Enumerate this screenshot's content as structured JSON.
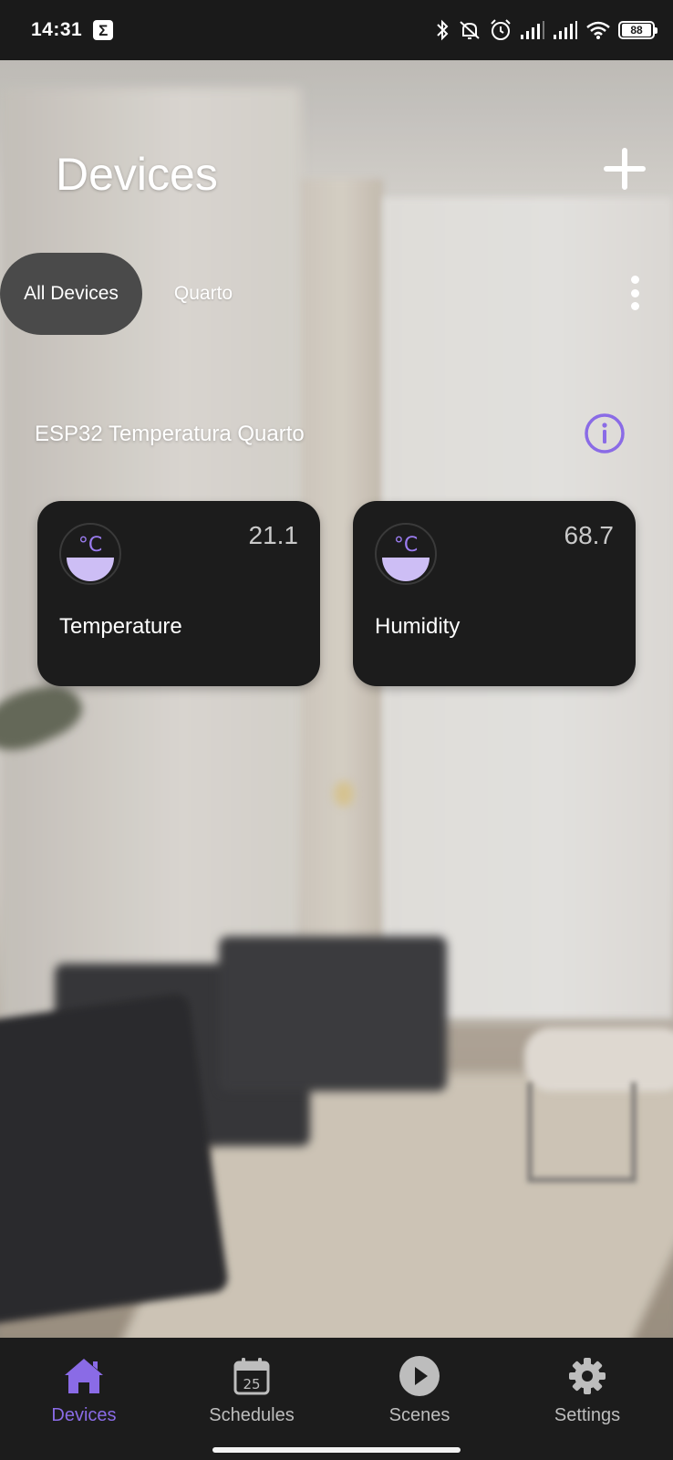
{
  "status_bar": {
    "time": "14:31",
    "app_badge_icon": "sigma-icon",
    "icons": [
      "bluetooth-icon",
      "mute-icon",
      "alarm-icon",
      "signal-icon",
      "signal-icon",
      "wifi-icon"
    ],
    "battery": "88"
  },
  "header": {
    "title": "Devices",
    "add_icon": "plus-icon"
  },
  "filters": {
    "chips": [
      {
        "label": "All Devices",
        "selected": true
      },
      {
        "label": "Quarto",
        "selected": false
      }
    ],
    "more_icon": "more-vertical-icon"
  },
  "device_group": {
    "name": "ESP32 Temperatura Quarto",
    "info_icon": "info-icon",
    "sensors": [
      {
        "label": "Temperature",
        "value": "21.1",
        "unit_icon": "celsius-icon"
      },
      {
        "label": "Humidity",
        "value": "68.7",
        "unit_icon": "celsius-icon"
      }
    ]
  },
  "bottom_nav": {
    "items": [
      {
        "label": "Devices",
        "icon": "home-icon",
        "active": true
      },
      {
        "label": "Schedules",
        "icon": "calendar-icon",
        "calendar_day": "25",
        "active": false
      },
      {
        "label": "Scenes",
        "icon": "play-icon",
        "active": false
      },
      {
        "label": "Settings",
        "icon": "gear-icon",
        "active": false
      }
    ]
  },
  "colors": {
    "accent": "#8a6be6",
    "card_background": "#1c1c1c",
    "chip_selected": "#4a4a4a",
    "nav_background": "#1c1c1c"
  }
}
